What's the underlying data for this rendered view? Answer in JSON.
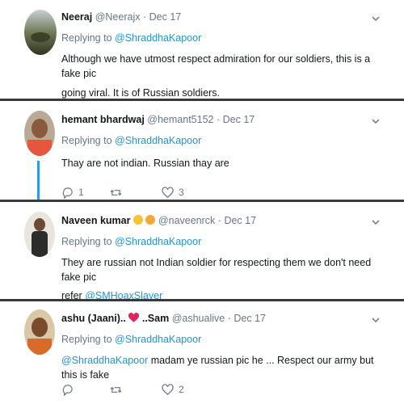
{
  "tweets": [
    {
      "name": "Neeraj",
      "handle": "@Neerajx",
      "dot": "·",
      "date": "Dec 17",
      "replying_prefix": "Replying to",
      "replying_to": "@ShraddhaKapoor",
      "body_lines": [
        "Although we have utmost respect admiration for our soldiers, this is a fake pic",
        "going viral. It is of Russian soldiers."
      ]
    },
    {
      "name": "hemant bhardwaj",
      "handle": "@hemant5152",
      "dot": "·",
      "date": "Dec 17",
      "replying_prefix": "Replying to",
      "replying_to": "@ShraddhaKapoor",
      "body_lines": [
        "Thay are not indian. Russian thay are"
      ],
      "reply_count": "1",
      "retweet_count": "",
      "like_count": "3"
    },
    {
      "name": "Naveen kumar",
      "handle": "@naveenrck",
      "dot": "·",
      "date": "Dec 17",
      "replying_prefix": "Replying to",
      "replying_to": "@ShraddhaKapoor",
      "body_lines": [
        "They are russian not Indian soldier for respecting them we don't need fake pic"
      ],
      "refer_text": "refer",
      "refer_mention": "@SMHoaxSlayer"
    },
    {
      "name_part1": "ashu (Jaani)..",
      "name_part2": "..Sam",
      "handle": "@ashualive",
      "dot": "·",
      "date": "Dec 17",
      "replying_prefix": "Replying to",
      "replying_to": "@ShraddhaKapoor",
      "body_mention": "@ShraddhaKapoor",
      "body_text": " madam ye russian pic he ... Respect our army but this is fake",
      "reply_count": "",
      "retweet_count": "",
      "like_count": "2"
    }
  ],
  "colors": {
    "link": "#1b95e0",
    "muted": "#657786",
    "thread_line": "#1da1f2",
    "separator": "#3a3a3a"
  },
  "icons": [
    "chevron-down-icon",
    "reply-icon",
    "retweet-icon",
    "like-icon",
    "heart-emoji"
  ]
}
